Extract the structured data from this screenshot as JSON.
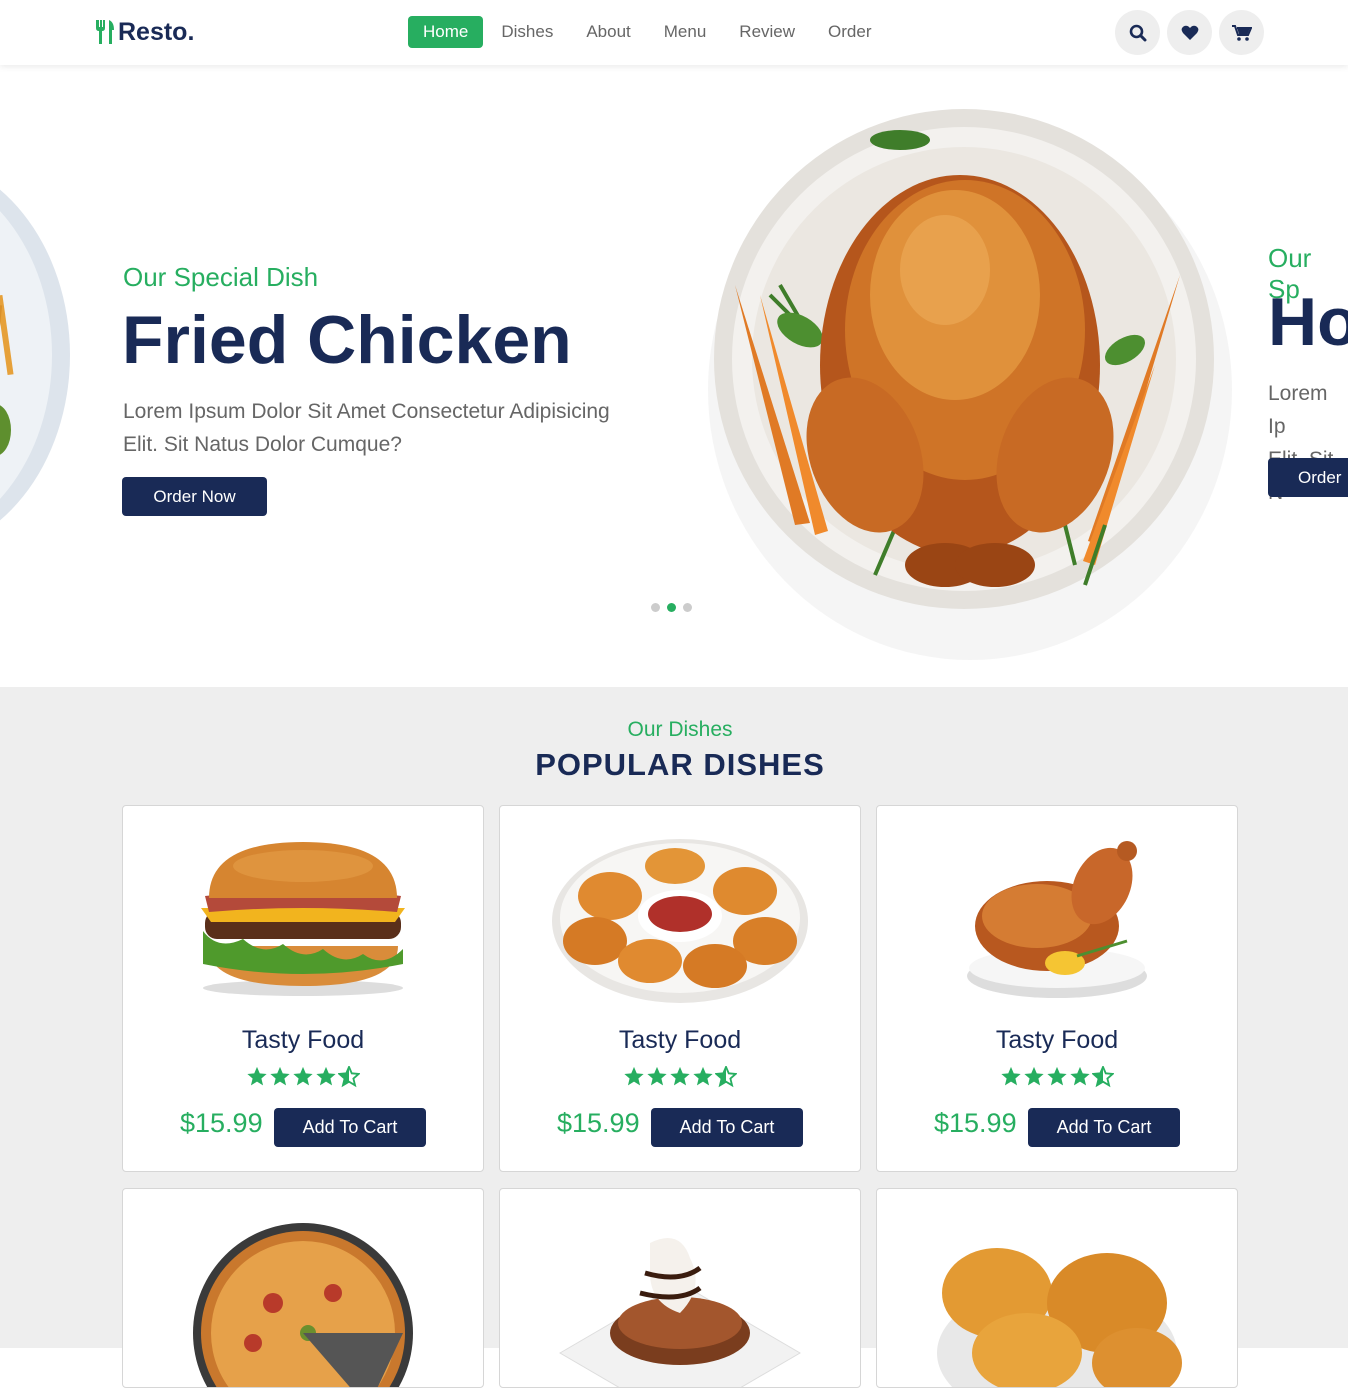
{
  "brand": {
    "name": "Resto."
  },
  "nav": {
    "items": [
      "Home",
      "Dishes",
      "About",
      "Menu",
      "Review",
      "Order"
    ],
    "active": "Home"
  },
  "header_icons": [
    "search-icon",
    "heart-icon",
    "cart-icon"
  ],
  "colors": {
    "primary": "#192a56",
    "accent": "#27ae60",
    "section_bg": "#eeeeee",
    "text_light": "#666666"
  },
  "hero": {
    "current_slide": {
      "subtitle": "Our Special Dish",
      "title": "Fried Chicken",
      "description_line1": "Lorem Ipsum Dolor Sit Amet Consectetur Adipisicing",
      "description_line2": "Elit. Sit Natus Dolor Cumque?",
      "button": "Order Now"
    },
    "next_slide_partial": {
      "subtitle": "Our Sp",
      "title": "Ho",
      "description_line1": "Lorem Ip",
      "description_line2": "Elit. Sit N",
      "button": "Order"
    },
    "slide_count": 3,
    "active_dot": 2
  },
  "section": {
    "subtitle": "Our Dishes",
    "title": "POPULAR DISHES"
  },
  "dishes": [
    {
      "name": "Tasty Food",
      "price": "$15.99",
      "rating": 4.5,
      "button": "Add To Cart",
      "image": "burger"
    },
    {
      "name": "Tasty Food",
      "price": "$15.99",
      "rating": 4.5,
      "button": "Add To Cart",
      "image": "chicken-nuggets"
    },
    {
      "name": "Tasty Food",
      "price": "$15.99",
      "rating": 4.5,
      "button": "Add To Cart",
      "image": "roast-chicken"
    },
    {
      "name": "",
      "price": "",
      "rating": null,
      "button": "",
      "image": "pizza"
    },
    {
      "name": "",
      "price": "",
      "rating": null,
      "button": "",
      "image": "chocolate-dessert"
    },
    {
      "name": "",
      "price": "",
      "rating": null,
      "button": "",
      "image": "fried-chicken"
    }
  ]
}
